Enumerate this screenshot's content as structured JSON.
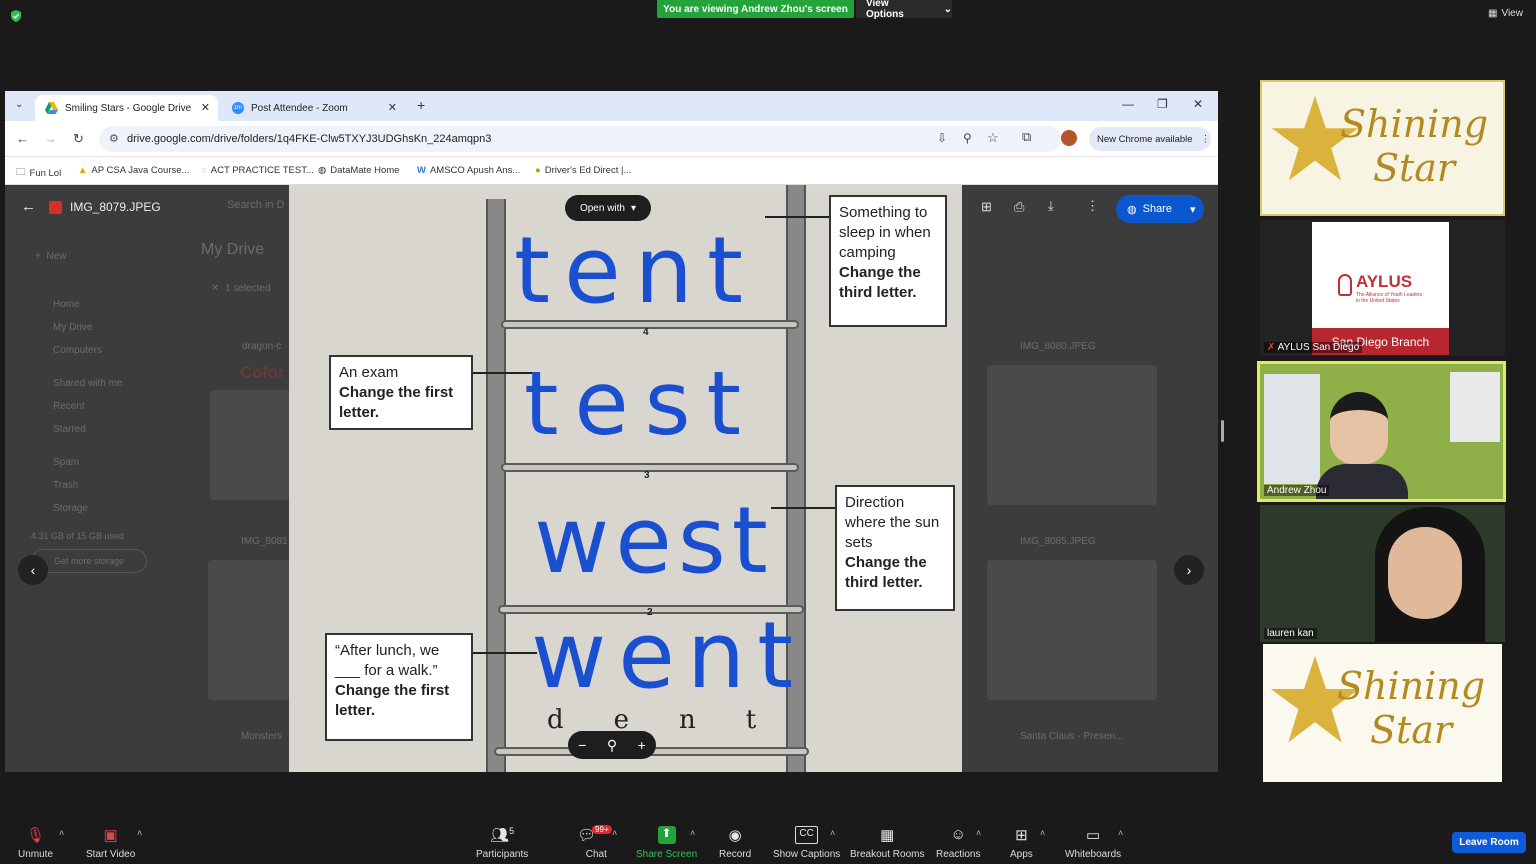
{
  "zoom": {
    "viewing_banner": "You are viewing Andrew Zhou's screen",
    "view_options": "View Options",
    "view_label": "View",
    "leave": "Leave Room",
    "toolbar": [
      {
        "label": "Unmute",
        "icon": "mic-muted-icon"
      },
      {
        "label": "Start Video",
        "icon": "video-off-icon"
      },
      {
        "label": "Participants",
        "icon": "participants-icon",
        "count": "5"
      },
      {
        "label": "Chat",
        "icon": "chat-icon",
        "badge": "99+"
      },
      {
        "label": "Share Screen",
        "icon": "share-screen-icon"
      },
      {
        "label": "Record",
        "icon": "record-icon"
      },
      {
        "label": "Show Captions",
        "icon": "captions-icon"
      },
      {
        "label": "Breakout Rooms",
        "icon": "breakout-rooms-icon"
      },
      {
        "label": "Reactions",
        "icon": "reactions-icon"
      },
      {
        "label": "Apps",
        "icon": "apps-icon"
      },
      {
        "label": "Whiteboards",
        "icon": "whiteboard-icon"
      }
    ],
    "participants": [
      {
        "name": "",
        "logo_text": "Shining Star"
      },
      {
        "name": "AYLUS San Diego",
        "logo_text": "AYLUS",
        "subtitle": "San Diego Branch",
        "tagline": "The Alliance of Youth Leaders in the United States"
      },
      {
        "name": "Andrew Zhou"
      },
      {
        "name": "lauren kan"
      },
      {
        "name": "",
        "logo_text": "Shining Star"
      }
    ]
  },
  "browser": {
    "tabs": [
      {
        "title": "Smiling Stars - Google Drive"
      },
      {
        "title": "Post Attendee - Zoom"
      }
    ],
    "url": "drive.google.com/drive/folders/1q4FKE-Clw5TXYJ3UDGhsKn_224amqpn3",
    "new_chrome": "New Chrome available",
    "bookmarks": [
      "Fun Lol",
      "AP CSA Java Course...",
      "ACT PRACTICE TEST...",
      "DataMate Home",
      "AMSCO Apush Ans...",
      "Driver's Ed Direct |..."
    ]
  },
  "drive": {
    "file_name": "IMG_8079.JPEG",
    "open_with": "Open with",
    "share": "Share",
    "bg": {
      "search": "Search in D",
      "my_drive": "My Drive",
      "new": "New",
      "selected": "1 selected",
      "sidebar": [
        "Home",
        "My Drive",
        "Computers",
        "Shared with me",
        "Recent",
        "Starred",
        "Spam",
        "Trash",
        "Storage"
      ],
      "storage": "4.31 GB of 15 GB used",
      "get_storage": "Get more storage",
      "files": [
        "dragon-c",
        "IMG_8080.JPEG",
        "IMG_8081",
        "IMG_8085.JPEG",
        "Monsters",
        "Santa Claus - Presen..."
      ],
      "color_word": "Color"
    }
  },
  "worksheet": {
    "clues": [
      {
        "line1": "Something to",
        "line2": "sleep in when",
        "line3": "camping",
        "instr1": "Change the",
        "instr2": "third letter."
      },
      {
        "line1": "An exam",
        "line2": "",
        "line3": "",
        "instr1": "Change the first",
        "instr2": "letter."
      },
      {
        "line1": "Direction",
        "line2": "where the sun",
        "line3": "sets",
        "instr1": "Change the",
        "instr2": "third letter."
      },
      {
        "line1": "“After lunch, we",
        "line2": "___ for a walk.”",
        "line3": "",
        "instr1": "Change the first",
        "instr2": "letter."
      }
    ],
    "rung_numbers": [
      "4",
      "3",
      "2"
    ],
    "written_words": [
      "tent",
      "test",
      "west",
      "went"
    ],
    "printed_word": [
      "d",
      "e",
      "n",
      "t"
    ],
    "ink_color": "#1a4fd0"
  }
}
